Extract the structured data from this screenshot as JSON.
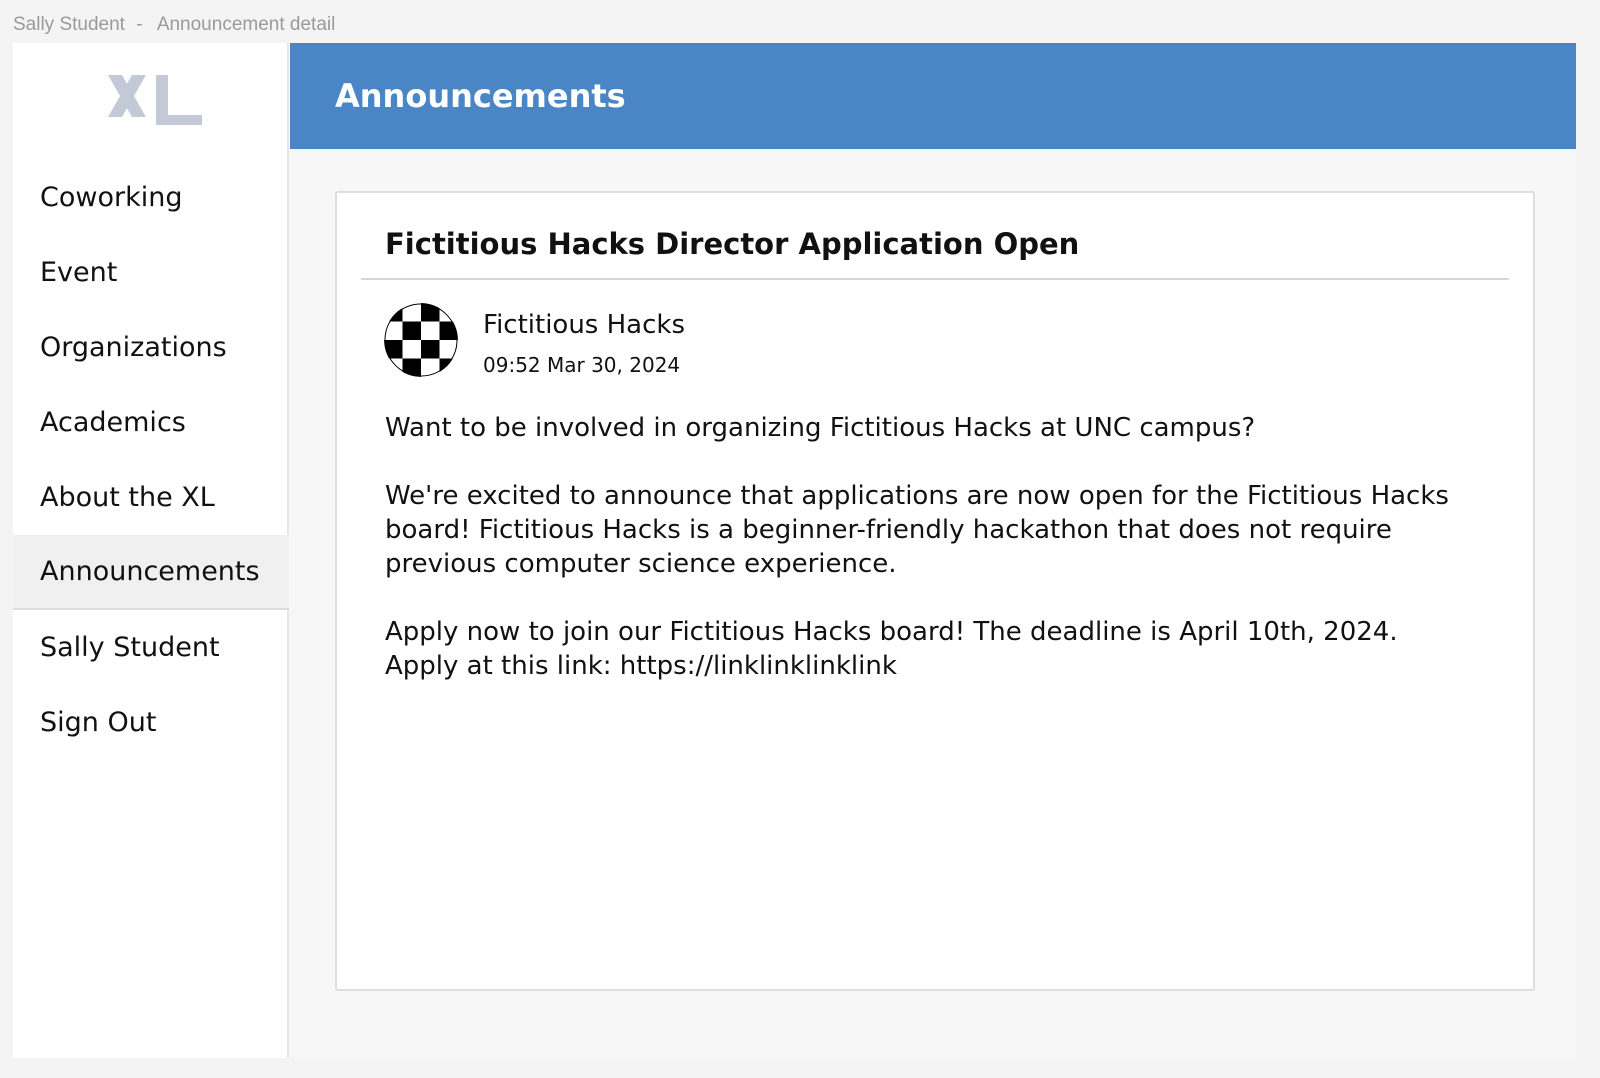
{
  "window": {
    "user": "Sally Student",
    "separator": "-",
    "page": "Announcement detail"
  },
  "sidebar": {
    "logo_icon": "xl-logo",
    "items": [
      {
        "label": "Coworking",
        "active": false
      },
      {
        "label": "Event",
        "active": false
      },
      {
        "label": "Organizations",
        "active": false
      },
      {
        "label": "Academics",
        "active": false
      },
      {
        "label": "About the XL",
        "active": false
      },
      {
        "label": "Announcements",
        "active": true
      },
      {
        "label": "Sally Student",
        "active": false
      },
      {
        "label": "Sign Out",
        "active": false
      }
    ]
  },
  "header": {
    "title": "Announcements"
  },
  "announcement": {
    "title": "Fictitious Hacks Director Application Open",
    "author": "Fictitious Hacks",
    "author_avatar_icon": "checkered-flag-avatar",
    "timestamp": "09:52 Mar 30, 2024",
    "paragraph_1": "Want to be involved in organizing Fictitious Hacks at UNC campus?",
    "paragraph_2": "We're excited to announce that applications are now open for the Fictitious Hacks board! Fictitious Hacks is a beginner-friendly hackathon that does not require previous computer science experience.",
    "paragraph_3_line_1": "Apply now to join our Fictitious Hacks board! The deadline is April 10th, 2024.",
    "paragraph_3_line_2": "Apply at this link: https://linklinklinklink"
  },
  "colors": {
    "header_bg": "#4a86c5",
    "logo": "#c3c9d6",
    "active_nav_bg": "#f0f0f0"
  }
}
